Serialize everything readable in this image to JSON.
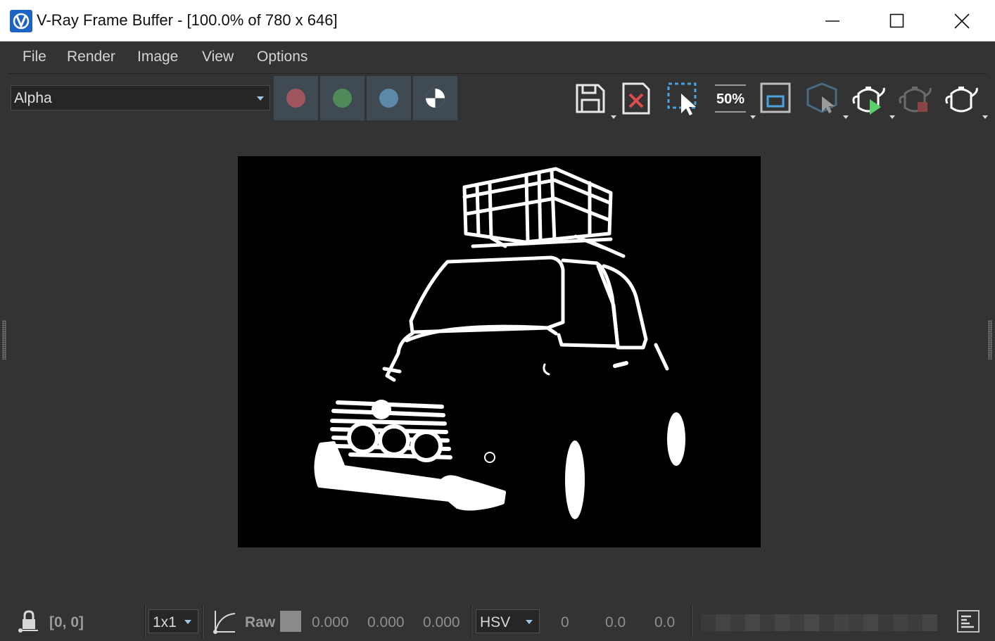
{
  "window": {
    "title": "V-Ray Frame Buffer - [100.0% of 780 x 646]",
    "icon": "vray-logo-icon",
    "controls": [
      "minimize-icon",
      "maximize-icon",
      "close-icon"
    ]
  },
  "menu": {
    "items": [
      "File",
      "Render",
      "Image",
      "View",
      "Options"
    ]
  },
  "toolbar": {
    "channel": "Alpha",
    "channel_buttons": [
      {
        "name": "red-channel",
        "color": "#a0555e"
      },
      {
        "name": "green-channel",
        "color": "#4f8a58"
      },
      {
        "name": "blue-channel",
        "color": "#5d88a6"
      },
      {
        "name": "alpha-channel",
        "color": "#ffffff"
      }
    ],
    "tools": [
      {
        "name": "save-image-icon",
        "dropdown": true
      },
      {
        "name": "clear-image-icon",
        "dropdown": false
      },
      {
        "name": "region-select-icon",
        "dropdown": false
      },
      {
        "name": "zoom-50-icon",
        "label": "50%",
        "dropdown": true
      },
      {
        "name": "region-render-icon",
        "dropdown": false
      },
      {
        "name": "track-mouse-icon",
        "dropdown": true
      },
      {
        "name": "render-teapot-icon",
        "dropdown": true
      },
      {
        "name": "stop-render-icon",
        "dropdown": false
      },
      {
        "name": "render-last-icon",
        "dropdown": true
      }
    ],
    "colors": {
      "accent_blue": "#4aa3df",
      "accent_red": "#e04b4b",
      "accent_green": "#5bd06a"
    }
  },
  "viewport": {
    "image_description_icon": "render-alpha-preview"
  },
  "status": {
    "lock_icon": "lock-pixel-icon",
    "coords": "[0, 0]",
    "sample_size": "1x1",
    "curve_icon": "curve-icon",
    "mode": "Raw",
    "r": "0.000",
    "g": "0.000",
    "b": "0.000",
    "color_space": "HSV",
    "h": "0",
    "s": "0.0",
    "v": "0.0",
    "log_icon": "log-icon"
  }
}
